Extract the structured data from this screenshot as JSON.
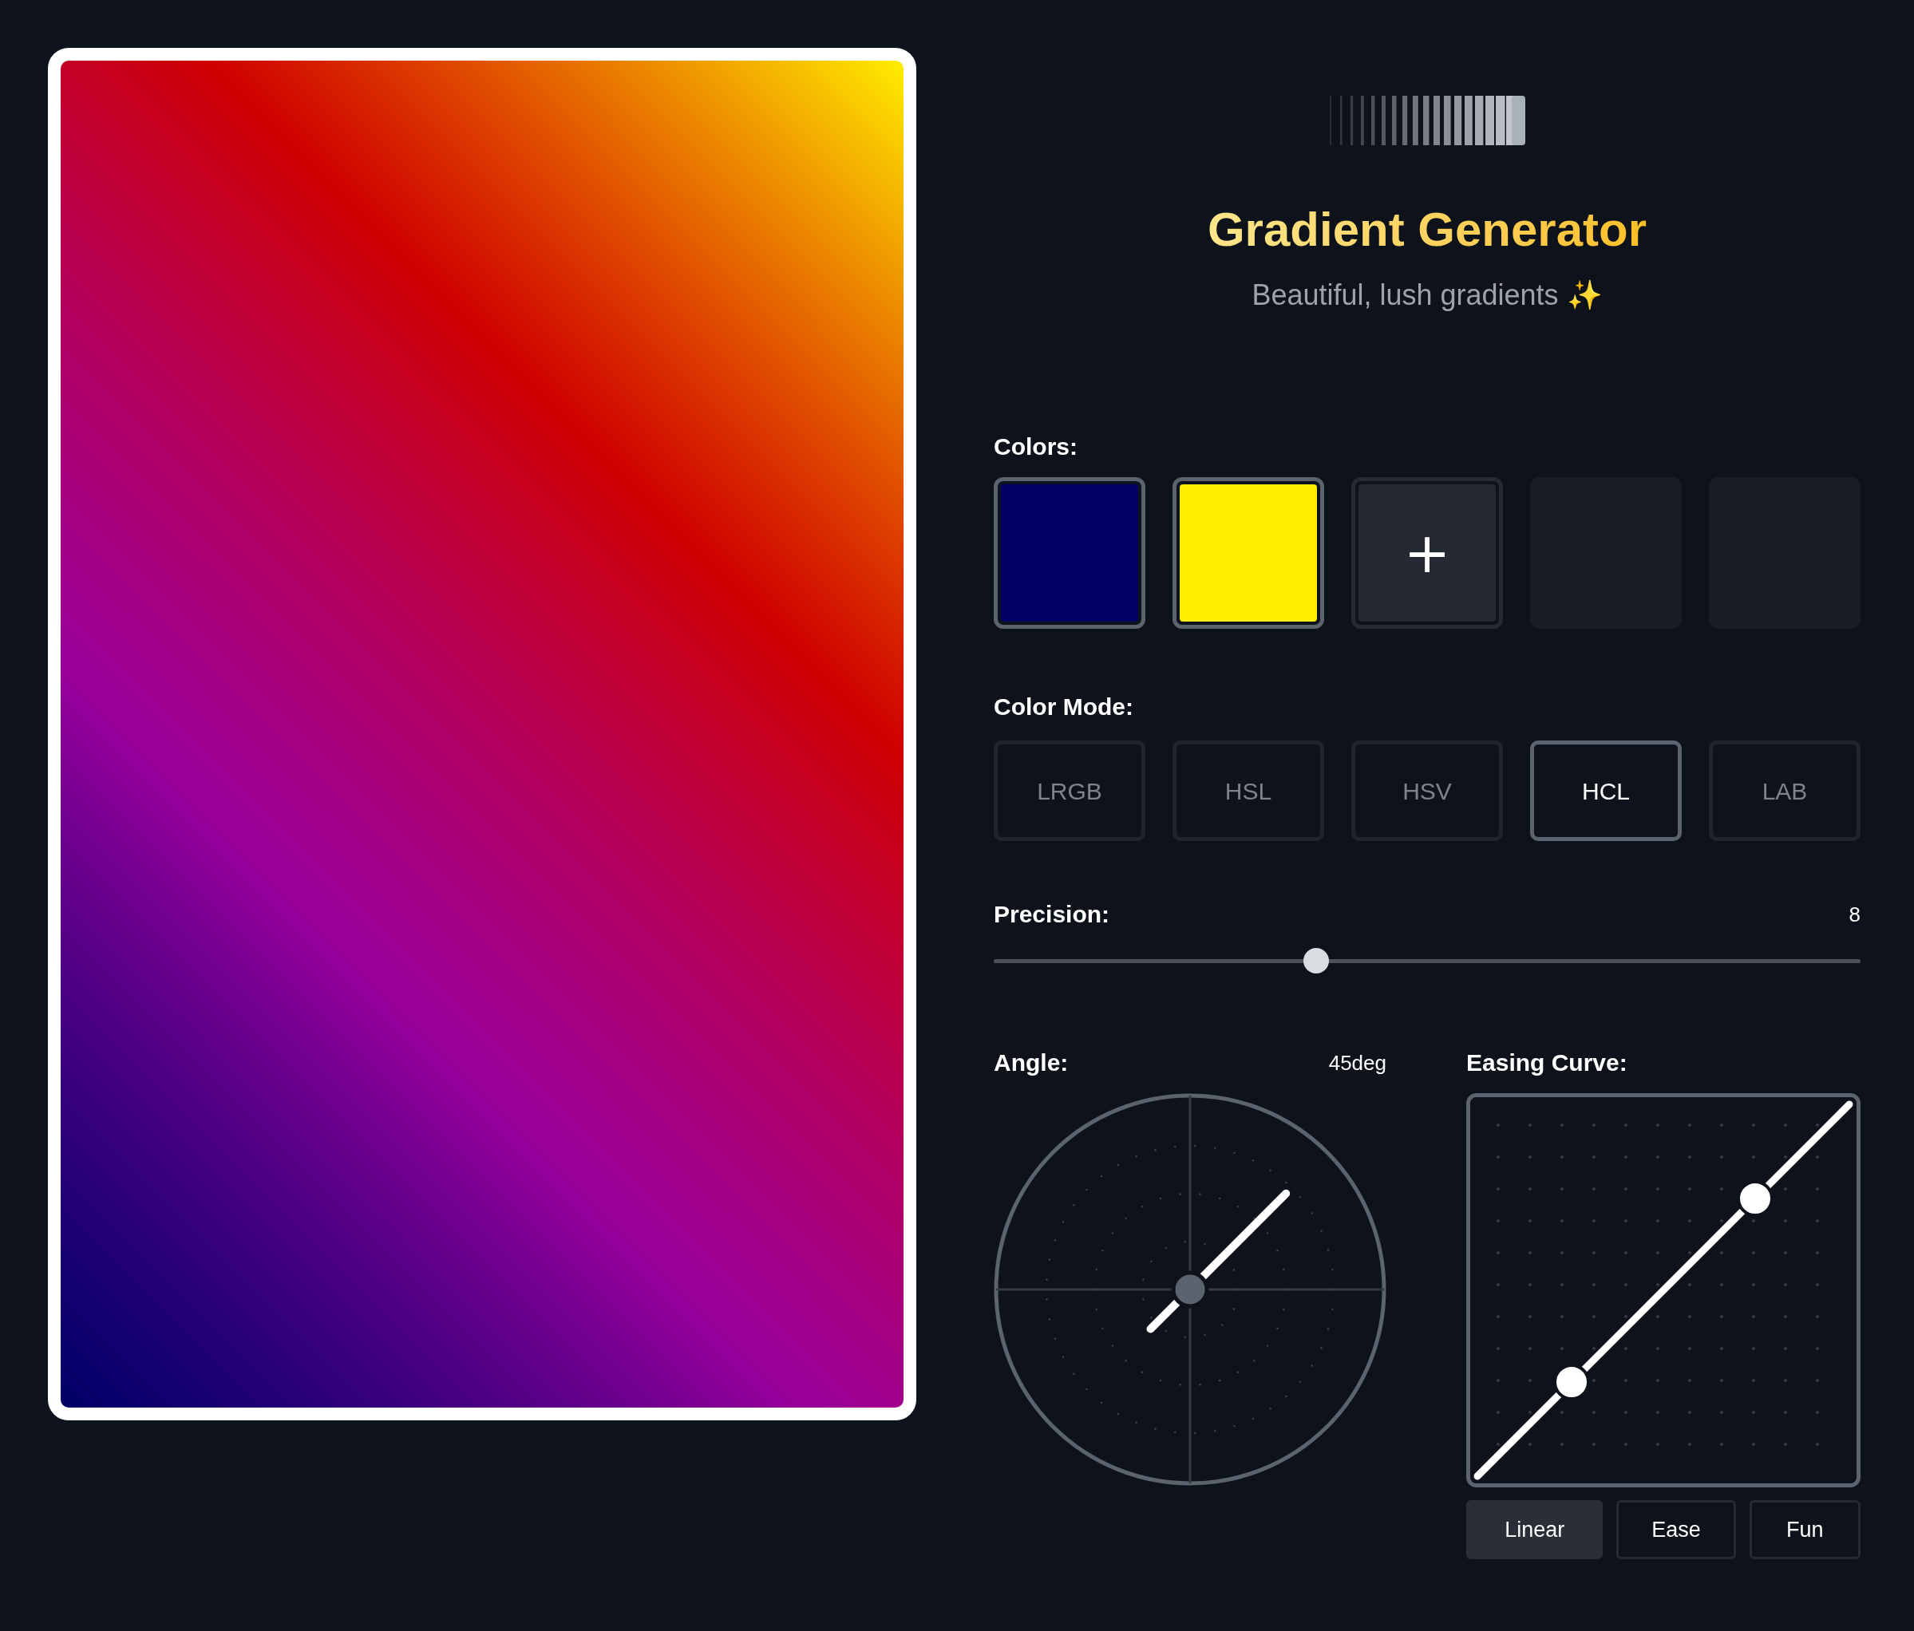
{
  "header": {
    "title": "Gradient Generator",
    "subtitle": "Beautiful, lush gradients ✨"
  },
  "colors": {
    "label": "Colors:",
    "slots": [
      {
        "kind": "color",
        "color": "#000066"
      },
      {
        "kind": "color",
        "color": "#ffee00"
      },
      {
        "kind": "add",
        "icon": "+"
      },
      {
        "kind": "empty"
      },
      {
        "kind": "empty"
      }
    ]
  },
  "color_mode": {
    "label": "Color Mode:",
    "options": [
      {
        "label": "LRGB",
        "selected": false
      },
      {
        "label": "HSL",
        "selected": false
      },
      {
        "label": "HSV",
        "selected": false
      },
      {
        "label": "HCL",
        "selected": true
      },
      {
        "label": "LAB",
        "selected": false
      }
    ]
  },
  "precision": {
    "label": "Precision:",
    "reading": "8",
    "level": 0.372
  },
  "angle": {
    "label": "Angle:",
    "reading": "45deg"
  },
  "easing": {
    "label": "Easing Curve:",
    "options": [
      {
        "label": "Linear",
        "selected": true
      },
      {
        "label": "Ease",
        "selected": false
      },
      {
        "label": "Fun",
        "selected": false
      }
    ]
  }
}
